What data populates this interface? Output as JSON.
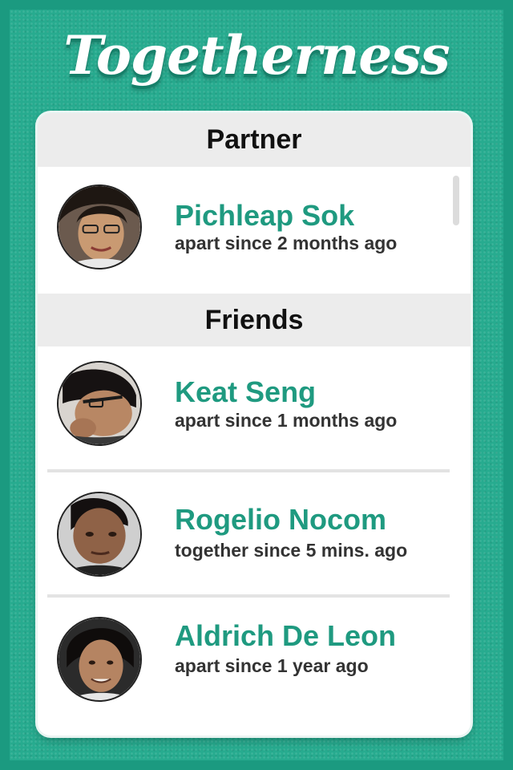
{
  "app": {
    "title": "Togetherness",
    "accent_color": "#1f9a80",
    "background_color": "#27ab8f"
  },
  "partner_section": {
    "heading": "Partner",
    "contacts": [
      {
        "name": "Pichleap Sok",
        "status": "apart since 2 months ago",
        "avatar_icon": "avatar-photo-icon"
      }
    ]
  },
  "friends_section": {
    "heading": "Friends",
    "contacts": [
      {
        "name": "Keat Seng",
        "status": "apart since 1 months ago",
        "avatar_icon": "avatar-photo-icon"
      },
      {
        "name": "Rogelio Nocom",
        "status": "together since 5 mins. ago",
        "avatar_icon": "avatar-photo-icon"
      },
      {
        "name": "Aldrich De Leon",
        "status": "apart since 1 year ago",
        "avatar_icon": "avatar-photo-icon"
      }
    ]
  }
}
